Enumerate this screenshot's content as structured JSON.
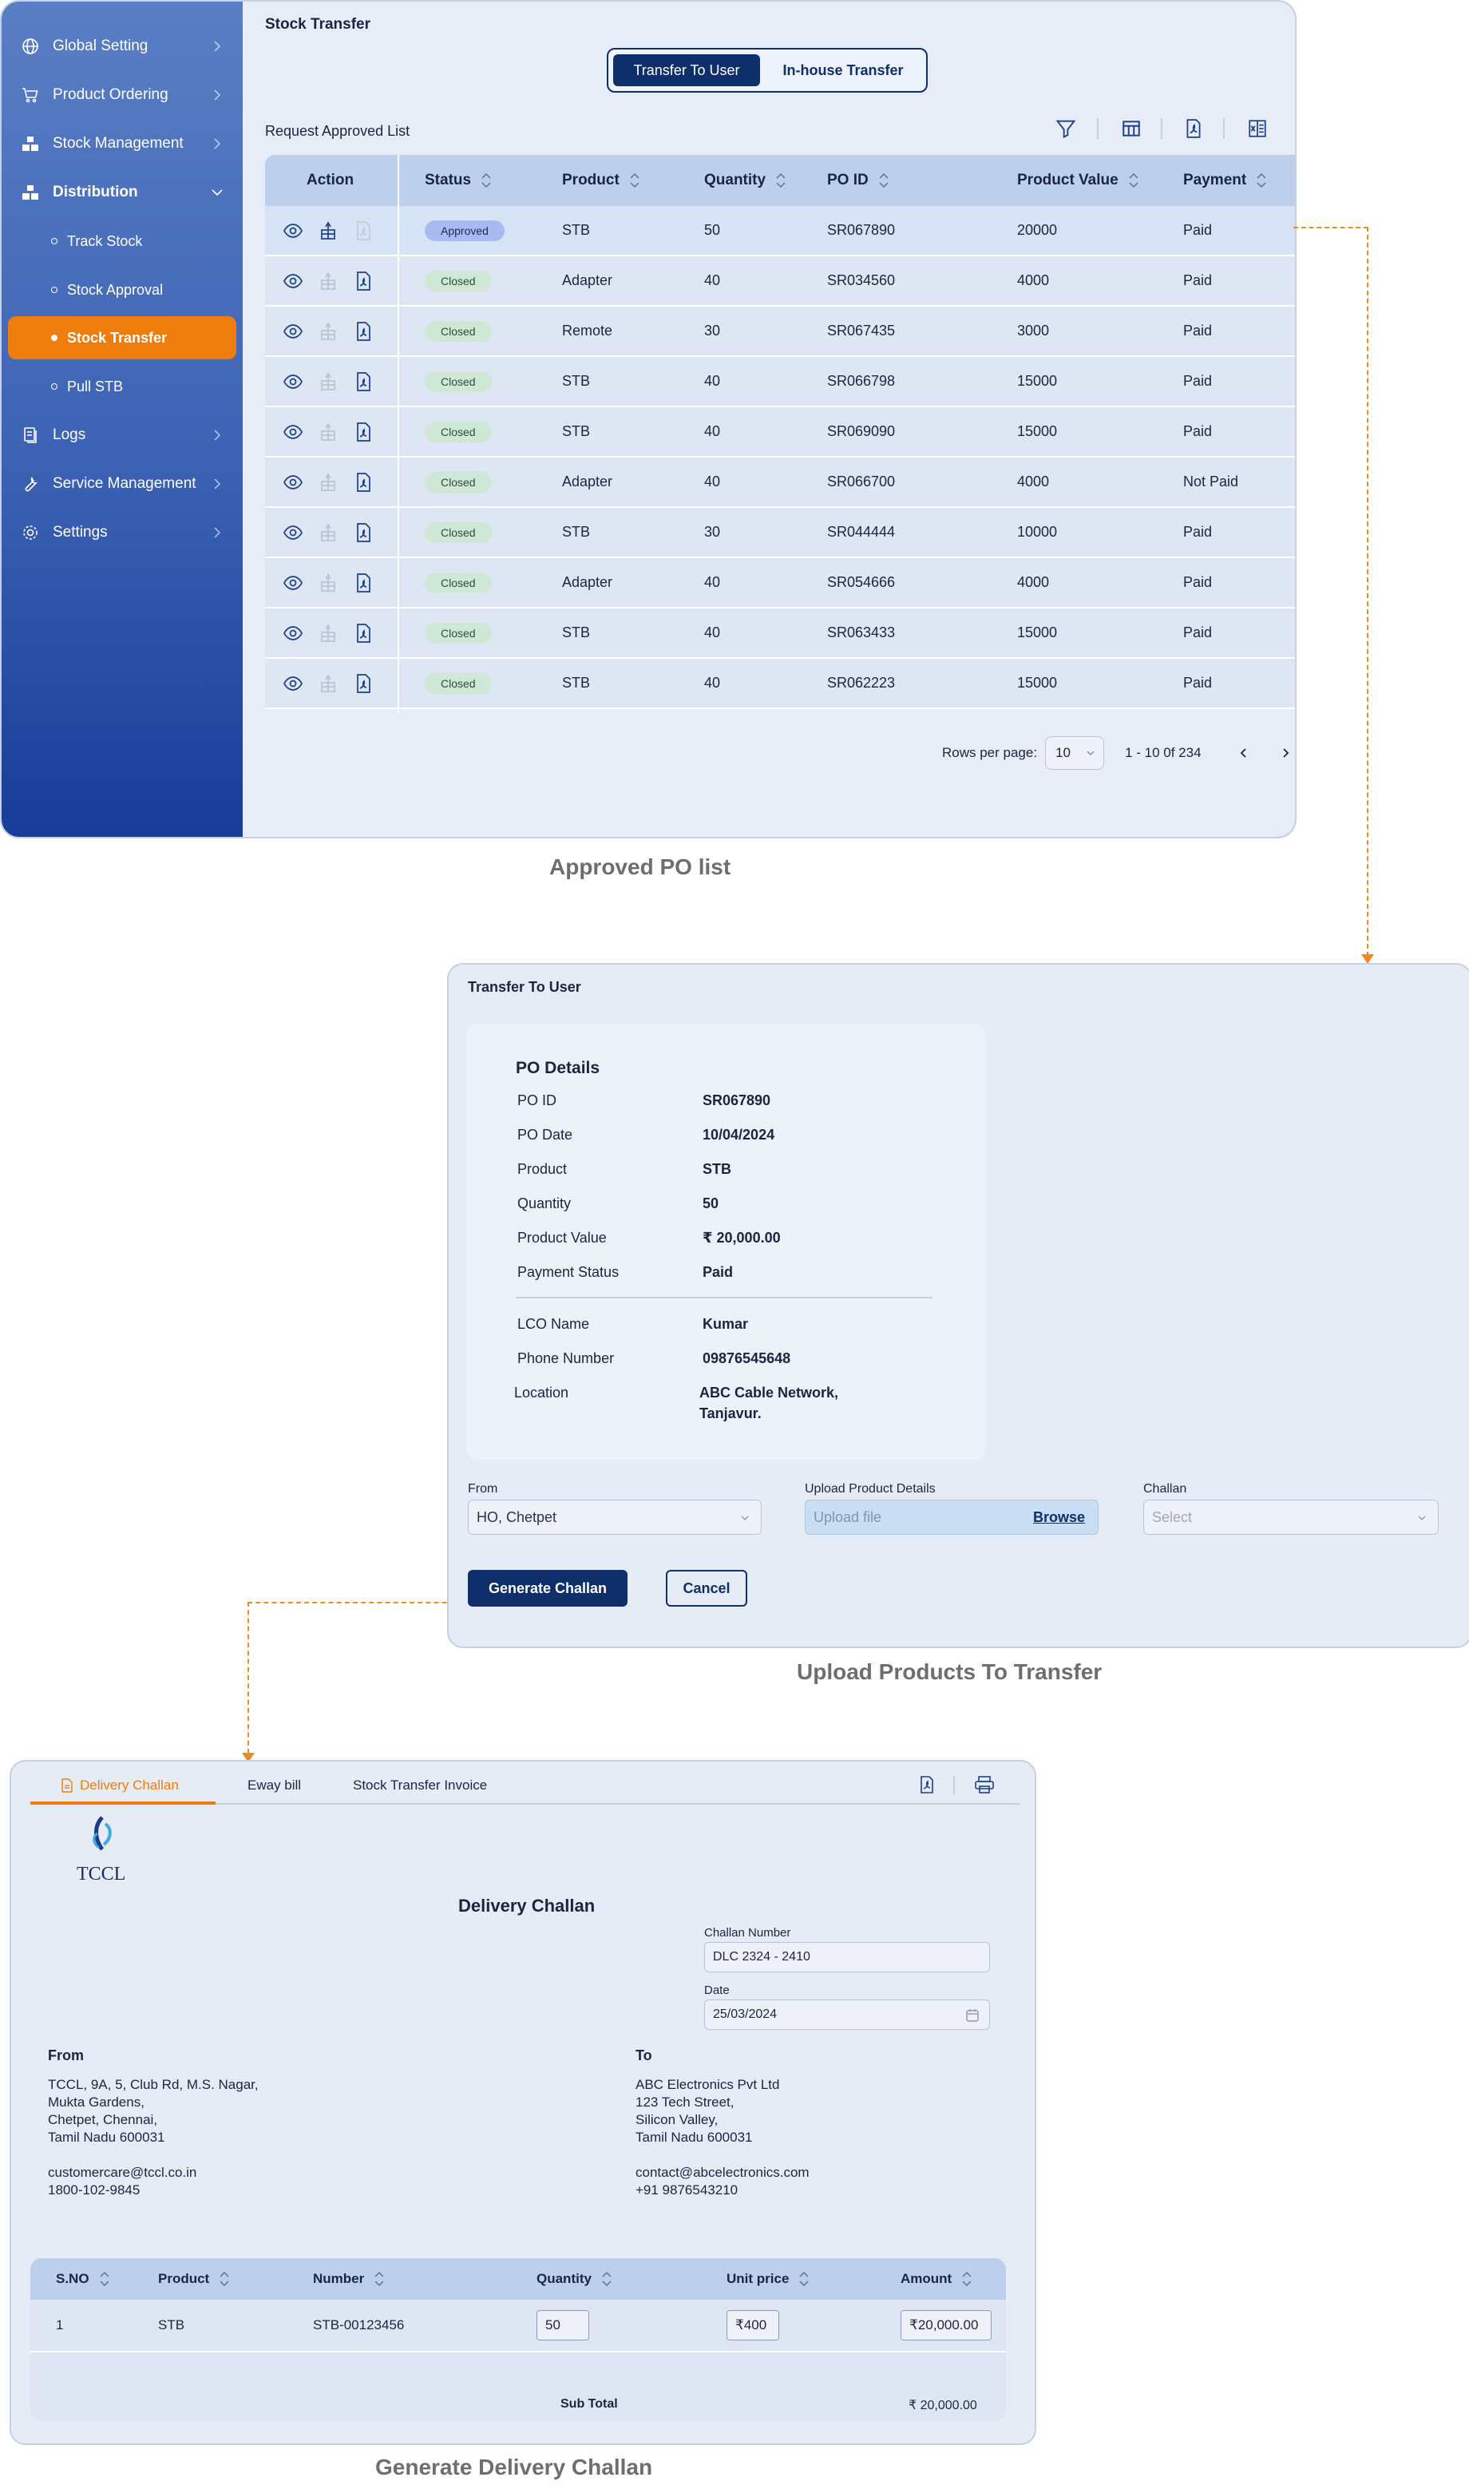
{
  "panel1": {
    "caption": "Approved PO list",
    "title": "Stock Transfer",
    "toggle": {
      "a": "Transfer To User",
      "b": "In-house Transfer"
    },
    "list_title": "Request Approved List",
    "nav": [
      {
        "label": "Global  Setting",
        "icon": "globe-icon"
      },
      {
        "label": "Product Ordering",
        "icon": "cart-icon"
      },
      {
        "label": "Stock Management",
        "icon": "boxes-icon"
      },
      {
        "label": "Distribution",
        "icon": "boxes-icon"
      },
      {
        "label": "Logs",
        "icon": "document-icon"
      },
      {
        "label": "Service Management",
        "icon": "wrench-icon"
      },
      {
        "label": "Settings",
        "icon": "gear-icon"
      }
    ],
    "subnav": [
      "Track Stock",
      "Stock Approval",
      "Stock Transfer",
      "Pull STB"
    ],
    "columns": [
      "Action",
      "Status",
      "Product",
      "Quantity",
      "PO ID",
      "Product Value",
      "Payment"
    ],
    "rows": [
      {
        "status": "Approved",
        "product": "STB",
        "qty": "50",
        "po": "SR067890",
        "value": "20000",
        "payment": "Paid"
      },
      {
        "status": "Closed",
        "product": "Adapter",
        "qty": "40",
        "po": "SR034560",
        "value": "4000",
        "payment": "Paid"
      },
      {
        "status": "Closed",
        "product": "Remote",
        "qty": "30",
        "po": "SR067435",
        "value": "3000",
        "payment": "Paid"
      },
      {
        "status": "Closed",
        "product": "STB",
        "qty": "40",
        "po": "SR066798",
        "value": "15000",
        "payment": "Paid"
      },
      {
        "status": "Closed",
        "product": "STB",
        "qty": "40",
        "po": "SR069090",
        "value": "15000",
        "payment": "Paid"
      },
      {
        "status": "Closed",
        "product": "Adapter",
        "qty": "40",
        "po": "SR066700",
        "value": "4000",
        "payment": "Not Paid"
      },
      {
        "status": "Closed",
        "product": "STB",
        "qty": "30",
        "po": "SR044444",
        "value": "10000",
        "payment": "Paid"
      },
      {
        "status": "Closed",
        "product": "Adapter",
        "qty": "40",
        "po": "SR054666",
        "value": "4000",
        "payment": "Paid"
      },
      {
        "status": "Closed",
        "product": "STB",
        "qty": "40",
        "po": "SR063433",
        "value": "15000",
        "payment": "Paid"
      },
      {
        "status": "Closed",
        "product": "STB",
        "qty": "40",
        "po": "SR062223",
        "value": "15000",
        "payment": "Paid"
      }
    ],
    "pager": {
      "rows_label": "Rows per page:",
      "rows_value": "10",
      "range": "1 - 10 0f 234"
    }
  },
  "panel2": {
    "caption": "Upload Products To Transfer",
    "title": "Transfer To User",
    "po_heading": "PO Details",
    "details": [
      {
        "k": "PO ID",
        "v": "SR067890"
      },
      {
        "k": "PO Date",
        "v": "10/04/2024"
      },
      {
        "k": "Product",
        "v": "STB"
      },
      {
        "k": "Quantity",
        "v": "50"
      },
      {
        "k": "Product Value",
        "v": "₹ 20,000.00"
      },
      {
        "k": "Payment Status",
        "v": "Paid"
      }
    ],
    "lco": [
      {
        "k": "LCO Name",
        "v": "Kumar"
      },
      {
        "k": "Phone Number",
        "v": "09876545648"
      }
    ],
    "location": {
      "k": "Location",
      "v1": "ABC Cable Network,",
      "v2": "Tanjavur."
    },
    "from_label": "From",
    "from_value": "HO, Chetpet",
    "upload_label": "Upload Product Details",
    "upload_placeholder": "Upload file",
    "browse": "Browse",
    "challan_label": "Challan",
    "challan_placeholder": "Select",
    "btn_generate": "Generate Challan",
    "btn_cancel": "Cancel"
  },
  "panel3": {
    "caption": "Generate Delivery Challan",
    "tabs": [
      "Delivery Challan",
      "Eway bill",
      "Stock Transfer Invoice"
    ],
    "logo": "TCCL",
    "title": "Delivery Challan",
    "challan_label": "Challan Number",
    "challan_value": "DLC 2324 - 2410",
    "date_label": "Date",
    "date_value": "25/03/2024",
    "from_label": "From",
    "from_lines": [
      "TCCL, 9A, 5, Club Rd, M.S. Nagar,",
      "Mukta Gardens,",
      "Chetpet, Chennai,",
      "Tamil Nadu 600031"
    ],
    "from_email": "customercare@tccl.co.in",
    "from_phone": "1800-102-9845",
    "to_label": "To",
    "to_lines": [
      "ABC Electronics Pvt Ltd",
      "123 Tech Street,",
      "Silicon Valley,",
      "Tamil Nadu 600031"
    ],
    "to_email": "contact@abcelectronics.com",
    "to_phone": "+91 9876543210",
    "columns": [
      "S.NO",
      "Product",
      "Number",
      "Quantity",
      "Unit price",
      "Amount"
    ],
    "item": {
      "sno": "1",
      "product": "STB",
      "number": "STB-00123456",
      "qty": "50",
      "unit": "₹400",
      "amount": "₹20,000.00"
    },
    "subtotal_label": "Sub Total",
    "subtotal_value": "₹ 20,000.00"
  },
  "colors": {
    "navy": "#0f2f6b",
    "orange": "#ee7d0e",
    "sidebar": "#3c62b4"
  }
}
